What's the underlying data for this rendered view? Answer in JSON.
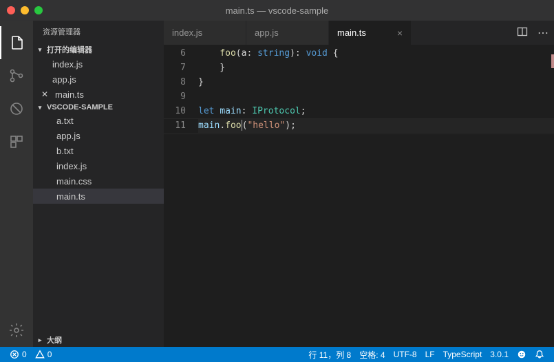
{
  "title": "main.ts — vscode-sample",
  "sidebar": {
    "header": "资源管理器",
    "openEditors": {
      "label": "打开的编辑器",
      "items": [
        {
          "label": "index.js"
        },
        {
          "label": "app.js"
        },
        {
          "label": "main.ts",
          "dirty": true
        }
      ]
    },
    "workspace": {
      "label": "VSCODE-SAMPLE",
      "items": [
        {
          "label": "a.txt"
        },
        {
          "label": "app.js"
        },
        {
          "label": "b.txt"
        },
        {
          "label": "index.js"
        },
        {
          "label": "main.css"
        },
        {
          "label": "main.ts",
          "active": true
        }
      ]
    },
    "outline": {
      "label": "大纲"
    }
  },
  "tabs": [
    {
      "label": "index.js"
    },
    {
      "label": "app.js"
    },
    {
      "label": "main.ts",
      "active": true
    }
  ],
  "editor": {
    "lines": [
      {
        "n": 6,
        "tokens": [
          [
            "pun",
            "    "
          ],
          [
            "fn",
            "foo"
          ],
          [
            "pun",
            "(a: "
          ],
          [
            "kw",
            "string"
          ],
          [
            "pun",
            "): "
          ],
          [
            "kw",
            "void"
          ],
          [
            "pun",
            " {"
          ]
        ]
      },
      {
        "n": 7,
        "tokens": [
          [
            "pun",
            "    }"
          ]
        ]
      },
      {
        "n": 8,
        "tokens": [
          [
            "pun",
            "}"
          ]
        ]
      },
      {
        "n": 9,
        "tokens": [
          [
            "pun",
            ""
          ]
        ]
      },
      {
        "n": 10,
        "tokens": [
          [
            "kw",
            "let"
          ],
          [
            "pun",
            " "
          ],
          [
            "var",
            "main"
          ],
          [
            "pun",
            ": "
          ],
          [
            "type",
            "IProtocol"
          ],
          [
            "pun",
            ";"
          ]
        ]
      },
      {
        "n": 11,
        "tokens": [
          [
            "var",
            "main"
          ],
          [
            "pun",
            "."
          ],
          [
            "fn",
            "foo"
          ],
          [
            "pun",
            "("
          ],
          [
            "str",
            "\"hello\""
          ],
          [
            "pun",
            ");"
          ]
        ],
        "current": true,
        "cursorAfter": 2
      }
    ]
  },
  "status": {
    "errors": "0",
    "warnings": "0",
    "lineCol": "行 11，列 8",
    "spaces": "空格: 4",
    "encoding": "UTF-8",
    "eol": "LF",
    "lang": "TypeScript",
    "version": "3.0.1"
  }
}
